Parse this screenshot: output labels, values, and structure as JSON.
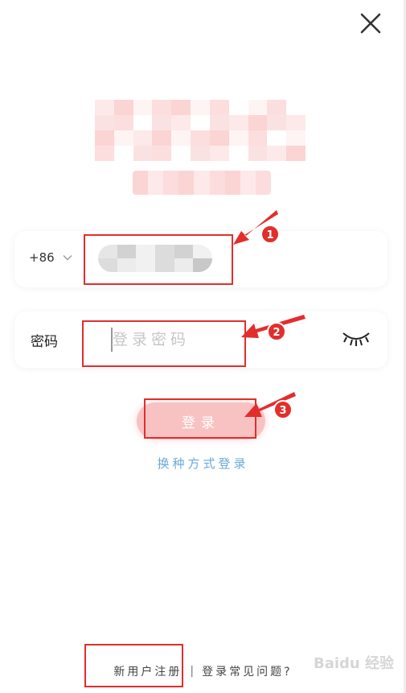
{
  "phone": {
    "country_code": "+86"
  },
  "password": {
    "label": "密码",
    "placeholder": "登录密码"
  },
  "login": {
    "button_label": "登录"
  },
  "switch_login": "换种方式登录",
  "footer": {
    "register": "新用户注册",
    "separator": "|",
    "help": "登录常见问题?"
  },
  "annotations": [
    "1",
    "2",
    "3"
  ],
  "watermark": "Baidu 经验",
  "icons": {
    "close": "close-icon",
    "chevron": "chevron-down-icon",
    "eye": "eye-closed-icon"
  },
  "colors": {
    "accent": "#f9c2c2",
    "link": "#6aa9d8",
    "annotation": "#e32d2d",
    "mosaic_light": "#fde9e9",
    "mosaic_mid": "#fbd4d4"
  }
}
